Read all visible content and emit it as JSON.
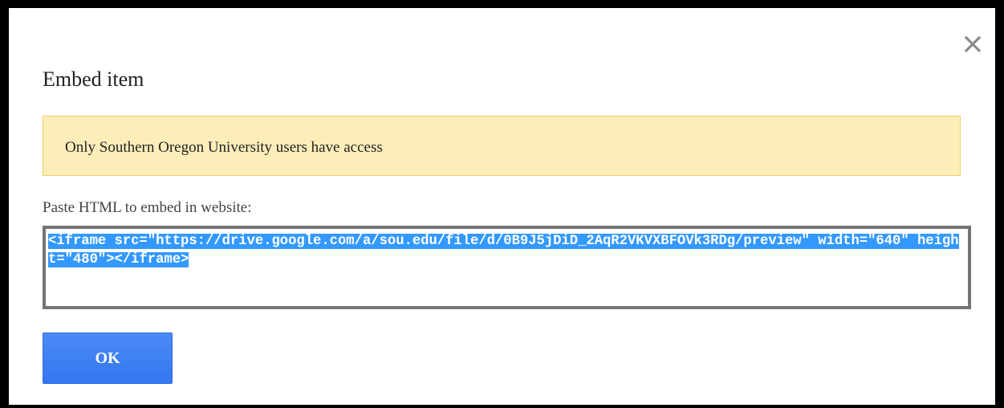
{
  "dialog": {
    "title": "Embed item",
    "close_icon": "close-icon",
    "notice": {
      "text": "Only Southern Oregon University users have access",
      "background_color": "#fdeeb9",
      "border_color": "#f3cd6a"
    },
    "embed_label": "Paste HTML to embed in website:",
    "embed_code": "<iframe src=\"https://drive.google.com/a/sou.edu/file/d/0B9J5jDiD_2AqR2VKVXBFOVk3RDg/preview\" width=\"640\" height=\"480\"></iframe>",
    "embed_code_selected": true,
    "selection_color": "#3399ff",
    "ok_button": {
      "label": "OK",
      "color": "#3d7ff2"
    }
  }
}
